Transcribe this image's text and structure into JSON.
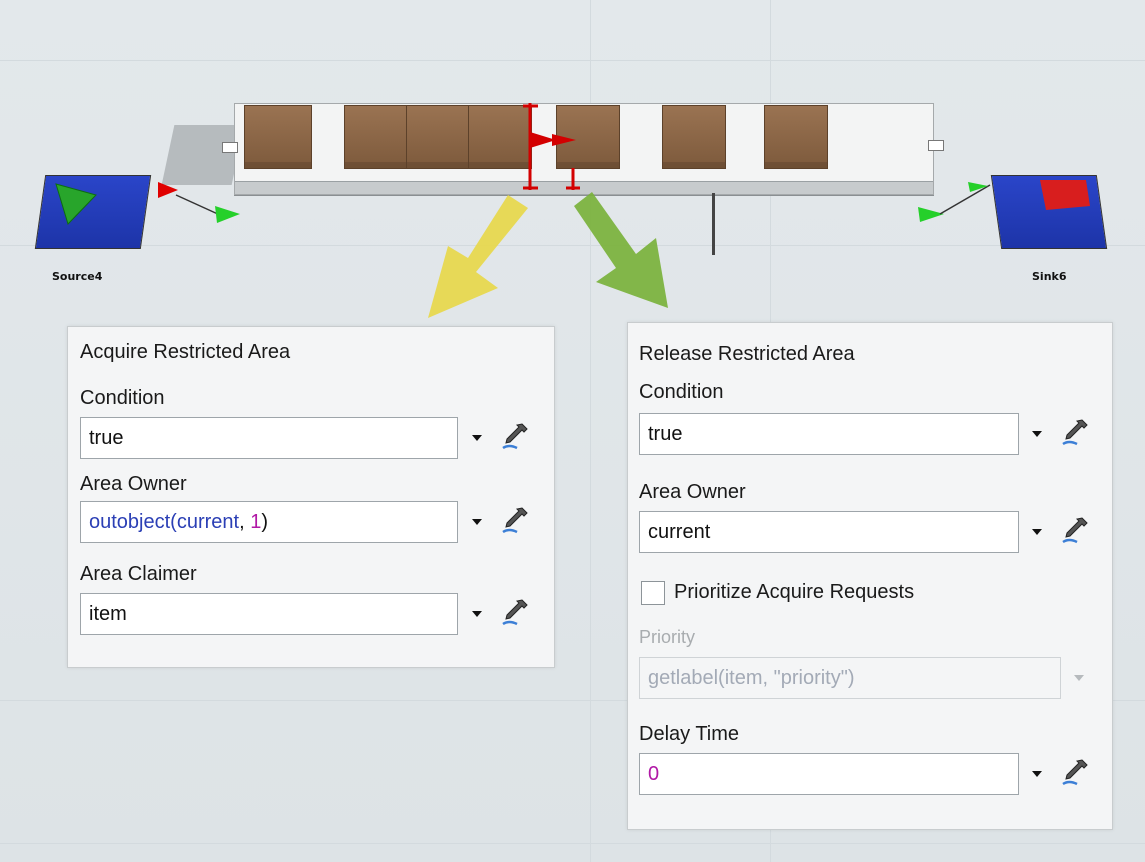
{
  "scene": {
    "source_label": "Source4",
    "sink_label": "Sink6"
  },
  "acquire_panel": {
    "title": "Acquire Restricted Area",
    "condition": {
      "label": "Condition",
      "value": "true"
    },
    "area_owner": {
      "label": "Area Owner",
      "value_fn": "outobject(",
      "value_arg": "current",
      "value_sep": ", ",
      "value_num": "1",
      "value_end": ")"
    },
    "area_claimer": {
      "label": "Area Claimer",
      "value": "item"
    }
  },
  "release_panel": {
    "title": "Release Restricted Area",
    "condition": {
      "label": "Condition",
      "value": "true"
    },
    "area_owner": {
      "label": "Area Owner",
      "value": "current"
    },
    "prioritize": {
      "label": "Prioritize Acquire Requests",
      "checked": false
    },
    "priority": {
      "label": "Priority",
      "value": "getlabel(item, \"priority\")",
      "disabled": true
    },
    "delay_time": {
      "label": "Delay Time",
      "value": "0"
    }
  },
  "colors": {
    "yellow_arrow": "#e7d84a",
    "green_arrow": "#79b23b",
    "keyword": "#2b3fb5",
    "number": "#b118a6"
  },
  "icons": [
    "dropdown-arrow-icon",
    "sampler-eyedropper-icon"
  ]
}
